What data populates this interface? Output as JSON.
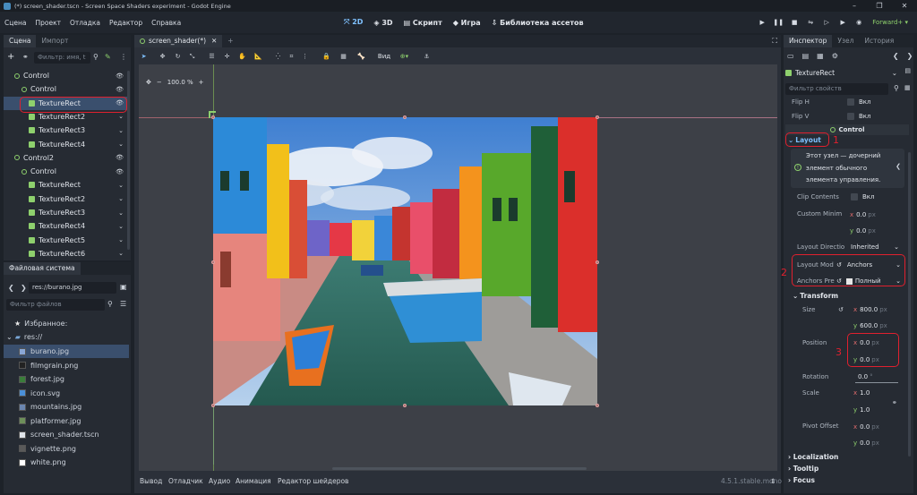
{
  "window": {
    "title": "(*) screen_shader.tscn - Screen Space Shaders experiment - Godot Engine"
  },
  "menu": [
    "Сцена",
    "Проект",
    "Отладка",
    "Редактор",
    "Справка"
  ],
  "workspaces": {
    "d2": "2D",
    "d3": "3D",
    "script": "Скрипт",
    "game": "Игра",
    "assetlib": "Библиотека ассетов"
  },
  "renderer": "Forward+",
  "scene_panel": {
    "tabs": [
      "Сцена",
      "Импорт"
    ],
    "filter_placeholder": "Фильтр: имя, t",
    "tree": [
      {
        "label": "Control",
        "type": "control",
        "eye": true
      },
      {
        "label": "Control",
        "type": "control",
        "eye": true
      },
      {
        "label": "TextureRect",
        "type": "texture",
        "eye": true
      },
      {
        "label": "TextureRect2",
        "type": "texture"
      },
      {
        "label": "TextureRect3",
        "type": "texture"
      },
      {
        "label": "TextureRect4",
        "type": "texture"
      },
      {
        "label": "Control2",
        "type": "control",
        "eye": true
      },
      {
        "label": "Control",
        "type": "control",
        "eye": true
      },
      {
        "label": "TextureRect",
        "type": "texture"
      },
      {
        "label": "TextureRect2",
        "type": "texture"
      },
      {
        "label": "TextureRect3",
        "type": "texture"
      },
      {
        "label": "TextureRect4",
        "type": "texture"
      },
      {
        "label": "TextureRect5",
        "type": "texture"
      },
      {
        "label": "TextureRect6",
        "type": "texture"
      }
    ]
  },
  "filesystem": {
    "title": "Файловая система",
    "path": "res://burano.jpg",
    "filter_placeholder": "Фильтр файлов",
    "favorites": "Избранное:",
    "root": "res://",
    "files": [
      "burano.jpg",
      "filmgrain.png",
      "forest.jpg",
      "icon.svg",
      "mountains.jpg",
      "platformer.jpg",
      "screen_shader.tscn",
      "vignette.png",
      "white.png"
    ]
  },
  "editor": {
    "tab": "screen_shader(*)",
    "view_menu": "Вид",
    "zoom": "100.0 %",
    "bottom_tabs": [
      "Вывод",
      "Отладчик",
      "Аудио",
      "Анимация",
      "Редактор шейдеров"
    ],
    "version": "4.5.1.stable.mono"
  },
  "inspector": {
    "tabs": [
      "Инспектор",
      "Узел",
      "История"
    ],
    "node": "TextureRect",
    "filter_placeholder": "Фильтр свойств",
    "flip_h": "Flip H",
    "flip_v": "Flip V",
    "on": "Вкл",
    "section_control": "Control",
    "section_layout": "Layout",
    "tooltip": [
      "Этот узел — дочерний",
      "элемент обычного",
      "элемента управления."
    ],
    "clip_contents": "Clip Contents",
    "custom_min": "Custom Minim",
    "custom_min_x": "0.0",
    "custom_min_y": "0.0",
    "layout_direction": "Layout Directio",
    "layout_direction_value": "Inherited",
    "layout_mode": "Layout Mod",
    "layout_mode_value": "Anchors",
    "anchors_preset": "Anchors Pre",
    "anchors_preset_value": "Полный",
    "section_transform": "Transform",
    "size": "Size",
    "size_x": "800.0",
    "size_y": "600.0",
    "position": "Position",
    "pos_x": "0.0",
    "pos_y": "0.0",
    "rotation": "Rotation",
    "rotation_value": "0.0",
    "scale": "Scale",
    "scale_x": "1.0",
    "scale_y": "1.0",
    "pivot": "Pivot Offset",
    "pivot_x": "0.0",
    "pivot_y": "0.0",
    "px": "px",
    "deg": "°",
    "sections": [
      "Localization",
      "Tooltip",
      "Focus"
    ]
  },
  "annotations": [
    "1",
    "2",
    "3"
  ],
  "colors": {
    "accent": "#7fc1ff",
    "node_green": "#8ed06d",
    "highlight_red": "#e0202e",
    "selected_row": "#3a4f6d"
  }
}
